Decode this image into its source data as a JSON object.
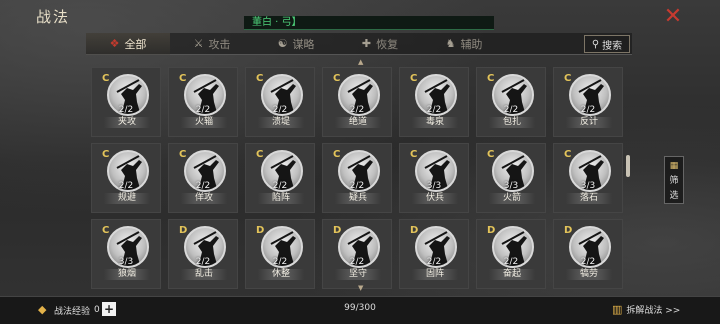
{
  "window": {
    "title": "战法",
    "close_icon": "close-icon"
  },
  "hint": {
    "text": "董白 · 弓】"
  },
  "tabs": [
    {
      "label": "全部",
      "icon": "all-icon",
      "active": true
    },
    {
      "label": "攻击",
      "icon": "crossed-swords-icon",
      "active": false
    },
    {
      "label": "谋略",
      "icon": "scroll-icon",
      "active": false
    },
    {
      "label": "恢复",
      "icon": "heal-icon",
      "active": false
    },
    {
      "label": "辅助",
      "icon": "support-icon",
      "active": false
    }
  ],
  "search": {
    "label": "搜索",
    "icon": "search-icon"
  },
  "filter": {
    "label_1": "筛",
    "label_2": "选",
    "icon": "filter-icon"
  },
  "skills": [
    {
      "grade": "C",
      "level": "2/2",
      "name": "夹攻"
    },
    {
      "grade": "C",
      "level": "2/2",
      "name": "火辎"
    },
    {
      "grade": "C",
      "level": "2/2",
      "name": "溃堤"
    },
    {
      "grade": "C",
      "level": "2/2",
      "name": "绝道"
    },
    {
      "grade": "C",
      "level": "2/2",
      "name": "毒泉"
    },
    {
      "grade": "C",
      "level": "2/2",
      "name": "包扎"
    },
    {
      "grade": "C",
      "level": "2/2",
      "name": "反计"
    },
    {
      "grade": "C",
      "level": "2/2",
      "name": "规避"
    },
    {
      "grade": "C",
      "level": "2/2",
      "name": "佯攻"
    },
    {
      "grade": "C",
      "level": "2/2",
      "name": "陷阵"
    },
    {
      "grade": "C",
      "level": "2/2",
      "name": "疑兵"
    },
    {
      "grade": "C",
      "level": "3/3",
      "name": "伏兵"
    },
    {
      "grade": "C",
      "level": "3/3",
      "name": "火箭"
    },
    {
      "grade": "C",
      "level": "3/3",
      "name": "落石"
    },
    {
      "grade": "C",
      "level": "3/3",
      "name": "狼烟"
    },
    {
      "grade": "D",
      "level": "2/2",
      "name": "乱击"
    },
    {
      "grade": "D",
      "level": "2/2",
      "name": "休整"
    },
    {
      "grade": "D",
      "level": "2/2",
      "name": "坚守"
    },
    {
      "grade": "D",
      "level": "2/2",
      "name": "固阵"
    },
    {
      "grade": "D",
      "level": "2/2",
      "name": "奋起"
    },
    {
      "grade": "D",
      "level": "2/2",
      "name": "犒劳"
    }
  ],
  "footer": {
    "exp_label": "战法经验",
    "exp_value": "0",
    "count": "99/300",
    "decompose_label": "拆解战法 >>"
  },
  "colors": {
    "accent_red": "#c83a30",
    "grade_gold": "#e3c45a",
    "hint_green": "#4ed07a"
  }
}
